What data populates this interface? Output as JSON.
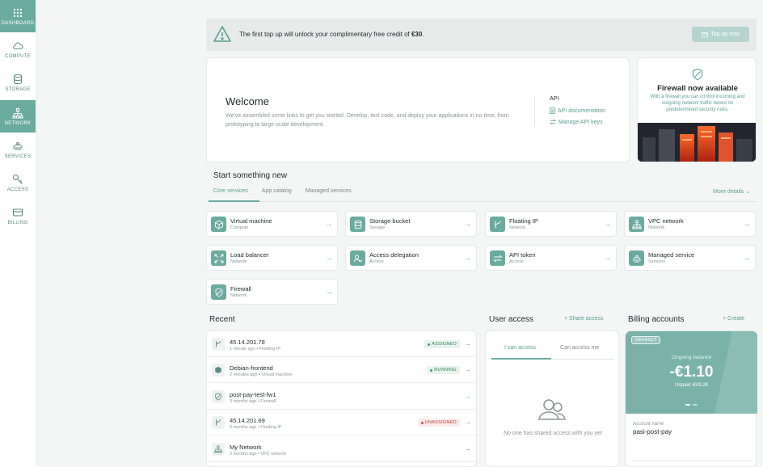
{
  "sidebar": {
    "items": [
      {
        "label": "DASHBOARD",
        "icon": "grid-icon",
        "active": true
      },
      {
        "label": "COMPUTE",
        "icon": "cloud-icon",
        "active": false
      },
      {
        "label": "STORAGE",
        "icon": "database-icon",
        "active": false
      },
      {
        "label": "NETWORK",
        "icon": "network-icon",
        "active": true
      },
      {
        "label": "SERVICES",
        "icon": "services-icon",
        "active": false
      },
      {
        "label": "ACCESS",
        "icon": "key-icon",
        "active": false
      },
      {
        "label": "BILLING",
        "icon": "card-icon",
        "active": false
      }
    ]
  },
  "banner": {
    "text_prefix": "The first top up will unlock your complimentary free credit of ",
    "text_bold": "€30",
    "text_suffix": ".",
    "button_label": "Top up now"
  },
  "welcome": {
    "title": "Welcome",
    "description": "We've assembled some links to get you started. Develop, test code, and deploy your applications in no time, from prototyping to large-scale development.",
    "api_title": "API",
    "api_links": [
      "API documentation",
      "Manage API keys"
    ]
  },
  "promo": {
    "title": "Firewall now available",
    "description": "With a firewall you can control incoming and outgoing network traffic based on predetermined security rules."
  },
  "start": {
    "title": "Start something new",
    "tabs": [
      "Core services",
      "App catalog",
      "Managed services"
    ],
    "more_details": "More details",
    "services": [
      {
        "name": "Virtual machine",
        "category": "Compute",
        "icon": "cube-icon"
      },
      {
        "name": "Storage bucket",
        "category": "Storage",
        "icon": "database-icon"
      },
      {
        "name": "Floating IP",
        "category": "Network",
        "icon": "branch-icon"
      },
      {
        "name": "VPC network",
        "category": "Network",
        "icon": "network-icon"
      },
      {
        "name": "Load balancer",
        "category": "Network",
        "icon": "expand-icon"
      },
      {
        "name": "Access delegation",
        "category": "Access",
        "icon": "users-icon"
      },
      {
        "name": "API token",
        "category": "Access",
        "icon": "swap-icon"
      },
      {
        "name": "Managed service",
        "category": "Services",
        "icon": "services-icon"
      },
      {
        "name": "Firewall",
        "category": "Network",
        "icon": "shield-icon"
      }
    ]
  },
  "recent": {
    "title": "Recent",
    "items": [
      {
        "name": "45.14.201.78",
        "meta": "1 minute ago • Floating IP",
        "badge": "ASSIGNED",
        "badge_type": "green",
        "icon": "branch-icon"
      },
      {
        "name": "Debian-frontend",
        "meta": "2 minutes ago • Virtual machine",
        "badge": "RUNNING",
        "badge_type": "green",
        "icon": "cube-icon"
      },
      {
        "name": "post-pay-test-fw1",
        "meta": "3 months ago • Firewall",
        "badge": "",
        "badge_type": "",
        "icon": "shield-icon"
      },
      {
        "name": "45.14.201.69",
        "meta": "3 months ago • Floating IP",
        "badge": "UNASSIGNED",
        "badge_type": "red",
        "icon": "branch-icon"
      },
      {
        "name": "My Network",
        "meta": "3 months ago • VPC network",
        "badge": "",
        "badge_type": "",
        "icon": "network-icon"
      }
    ]
  },
  "user_access": {
    "title": "User access",
    "share_link": "Share access",
    "tabs": [
      "I can access",
      "Can access me"
    ],
    "empty_text": "No one has shared access with you yet"
  },
  "billing": {
    "title": "Billing accounts",
    "create_link": "Create",
    "default_label": "DEFAULT",
    "balance_label": "Ongoing balance",
    "balance": "-€1.10",
    "unpaid": "Unpaid -€43.28",
    "account_label": "Account name",
    "account_name": "pasi-post-pay"
  },
  "colors": {
    "accent": "#6aaa9f",
    "link": "#5a9e93",
    "sidebar_active": "#6aaa9f",
    "banner_bg": "#e6ebea"
  }
}
